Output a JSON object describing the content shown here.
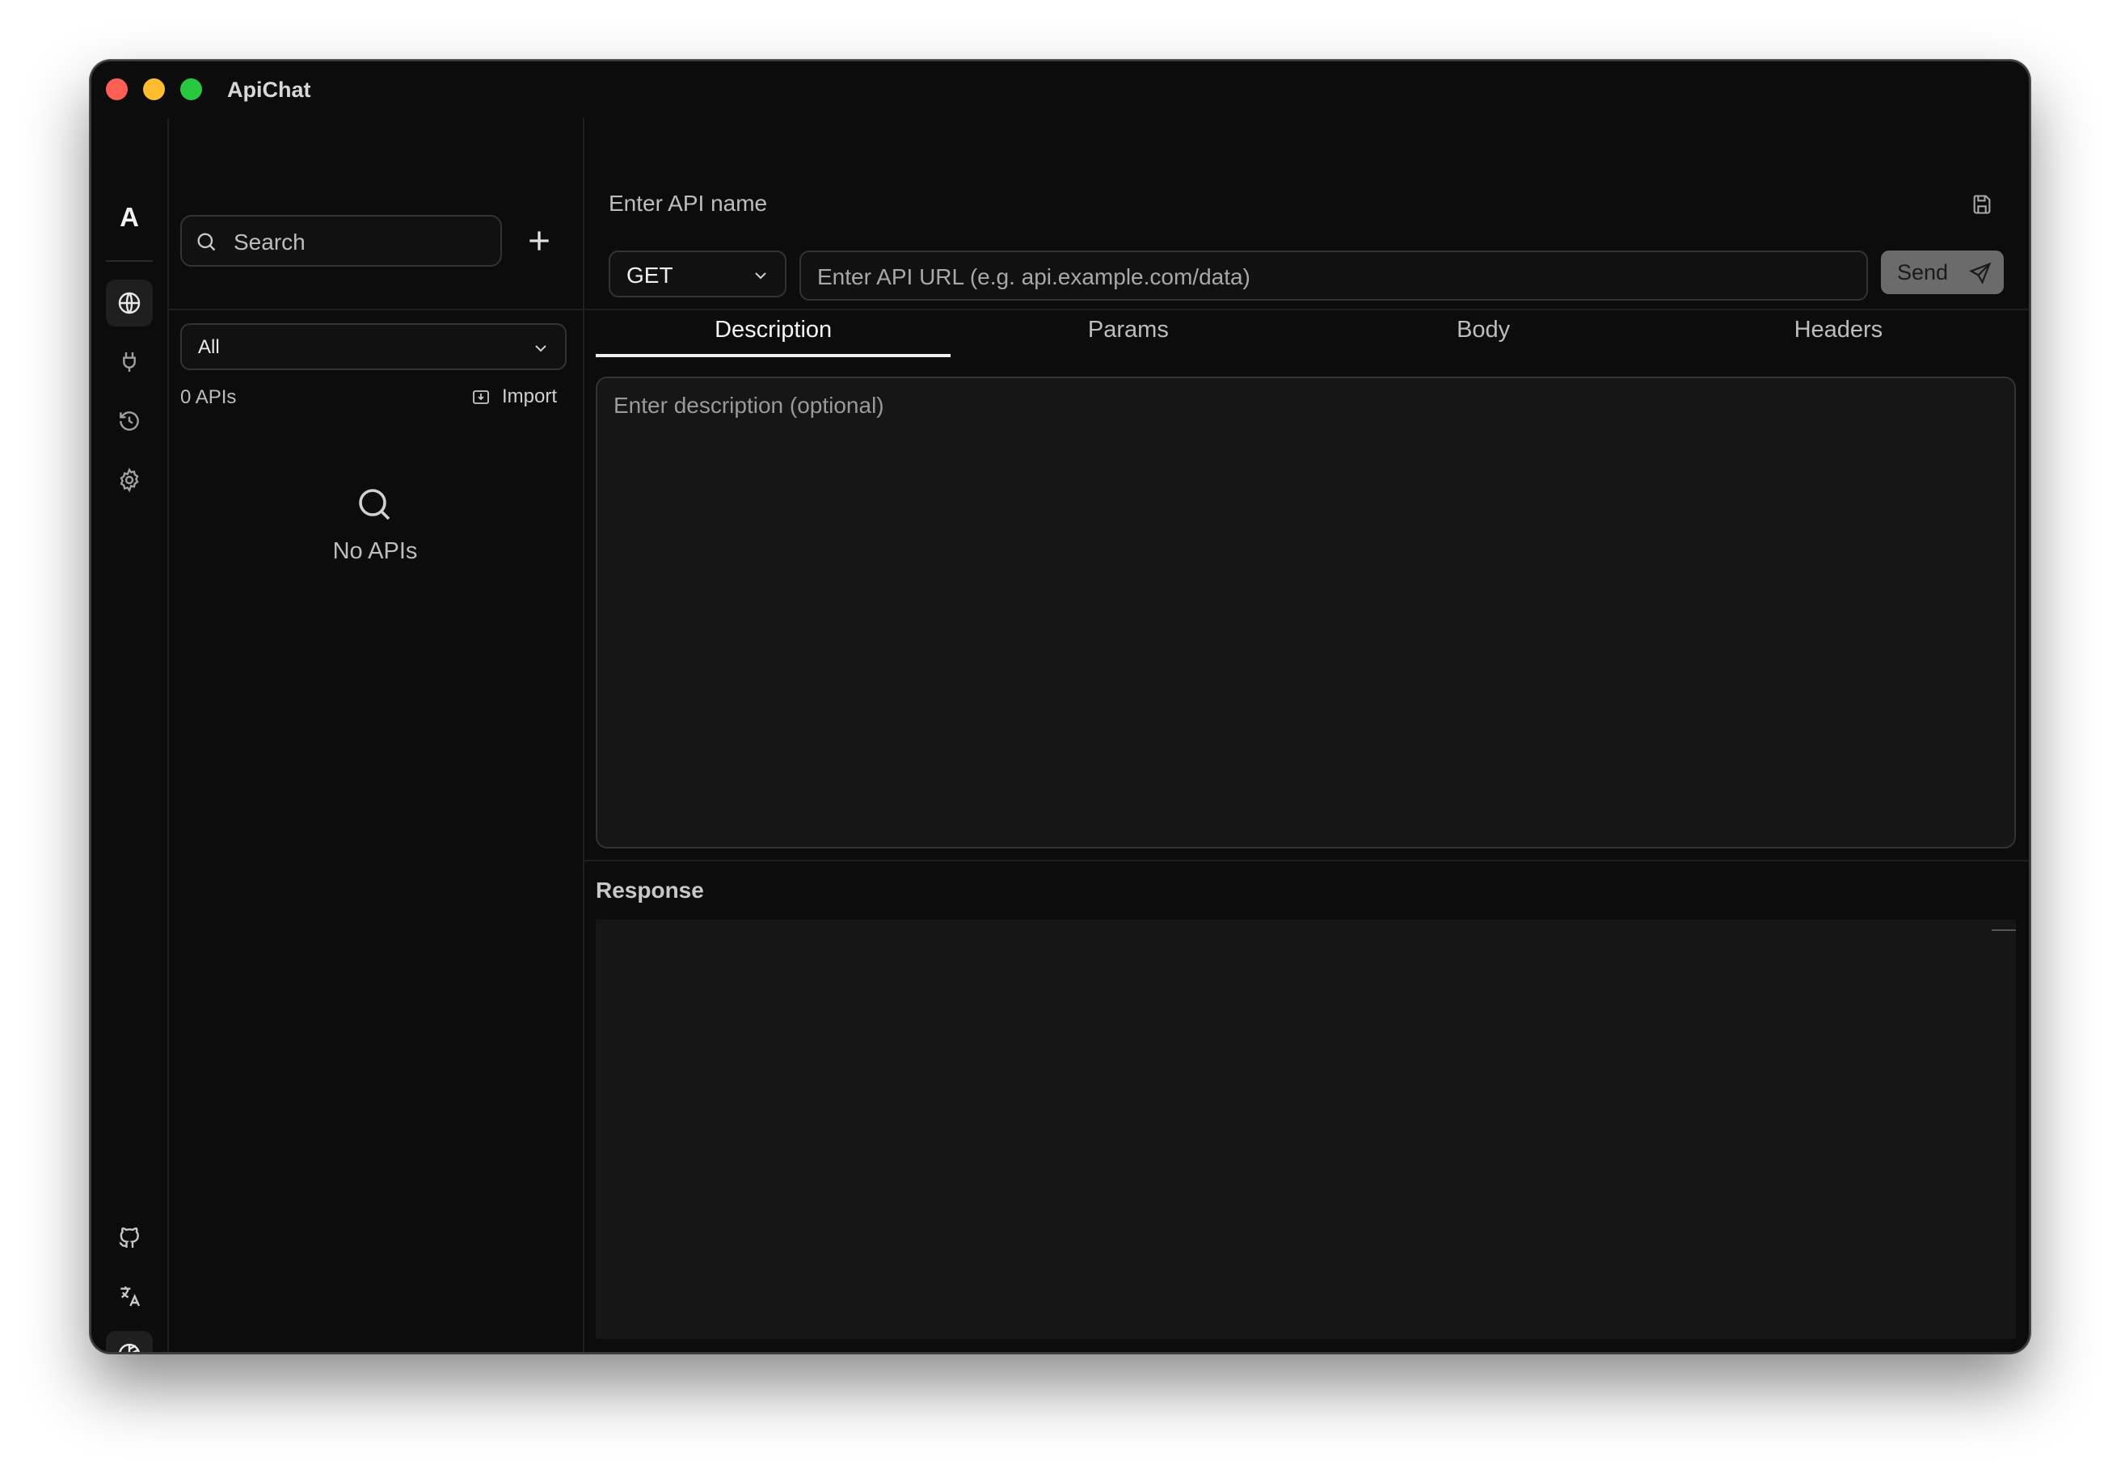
{
  "window": {
    "title": "ApiChat"
  },
  "rail": {
    "logo": "A",
    "top_icons": [
      "globe-icon",
      "plug-icon",
      "history-icon",
      "settings-icon"
    ],
    "bottom_icons": [
      "github-icon",
      "translate-icon",
      "theme-icon"
    ]
  },
  "list": {
    "search_placeholder": "Search",
    "filter_value": "All",
    "count_label": "0 APIs",
    "import_label": "Import",
    "empty_text": "No APIs"
  },
  "editor": {
    "name_placeholder": "Enter API name",
    "method": "GET",
    "url_placeholder": "Enter API URL (e.g. api.example.com/data)",
    "send_label": "Send",
    "tabs": [
      "Description",
      "Params",
      "Body",
      "Headers"
    ],
    "active_tab": "Description",
    "description_placeholder": "Enter description (optional)",
    "response_title": "Response"
  },
  "colors": {
    "close": "#fe5f57",
    "minimize": "#febc2e",
    "maximize": "#28c840",
    "background": "#0c0c0c"
  }
}
